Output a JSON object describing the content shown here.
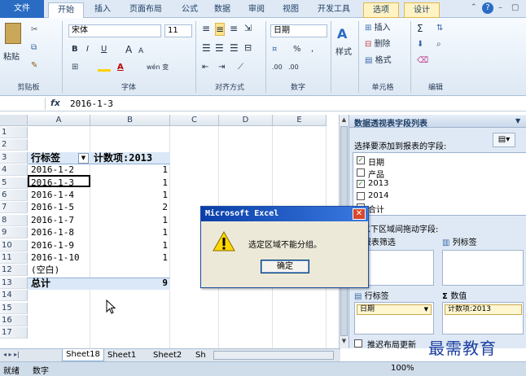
{
  "tabs": {
    "file": "文件",
    "home": "开始",
    "insert": "插入",
    "page_layout": "页面布局",
    "formulas": "公式",
    "data": "数据",
    "review": "审阅",
    "view": "视图",
    "developer": "开发工具",
    "options": "选项",
    "design": "设计"
  },
  "ribbon": {
    "clipboard": {
      "paste": "粘贴",
      "group": "剪贴板"
    },
    "font": {
      "name": "宋体",
      "size": "11",
      "group": "字体",
      "bold": "B",
      "italic": "I",
      "underline": "U",
      "grow": "A",
      "shrink": "A",
      "wen": "wén 变"
    },
    "alignment": {
      "group": "对齐方式"
    },
    "number": {
      "format": "日期",
      "group": "数字",
      "percent": "%",
      "comma": ",",
      "inc": ".00",
      "dec": ".00"
    },
    "styles": {
      "label": "样式"
    },
    "cells": {
      "insert": "插入",
      "delete": "删除",
      "format": "格式",
      "group": "单元格"
    },
    "editing": {
      "sum": "Σ",
      "group": "编辑"
    }
  },
  "formula_bar": {
    "fx": "fx",
    "value": "2016-1-3"
  },
  "columns": [
    "A",
    "B",
    "C",
    "D",
    "E"
  ],
  "rows": [
    {
      "n": "1",
      "a": "",
      "b": ""
    },
    {
      "n": "2",
      "a": "",
      "b": ""
    },
    {
      "n": "3",
      "a": "行标签",
      "b": "计数项:2013"
    },
    {
      "n": "4",
      "a": "2016-1-2",
      "b": "1"
    },
    {
      "n": "5",
      "a": "2016-1-3",
      "b": "1"
    },
    {
      "n": "6",
      "a": "2016-1-4",
      "b": "1"
    },
    {
      "n": "7",
      "a": "2016-1-5",
      "b": "2"
    },
    {
      "n": "8",
      "a": "2016-1-7",
      "b": "1"
    },
    {
      "n": "9",
      "a": "2016-1-8",
      "b": "1"
    },
    {
      "n": "10",
      "a": "2016-1-9",
      "b": "1"
    },
    {
      "n": "11",
      "a": "2016-1-10",
      "b": "1"
    },
    {
      "n": "12",
      "a": "(空白)",
      "b": ""
    },
    {
      "n": "13",
      "a": "总计",
      "b": "9"
    },
    {
      "n": "14",
      "a": "",
      "b": ""
    },
    {
      "n": "15",
      "a": "",
      "b": ""
    },
    {
      "n": "16",
      "a": "",
      "b": ""
    },
    {
      "n": "17",
      "a": "",
      "b": ""
    }
  ],
  "sheets": [
    "Sheet18",
    "Sheet1",
    "Sheet2",
    "Sh"
  ],
  "dialog": {
    "title": "Microsoft Excel",
    "message": "选定区域不能分组。",
    "ok": "确定"
  },
  "pivot_panel": {
    "title": "数据透视表字段列表",
    "choose_label": "选择要添加到报表的字段:",
    "fields": [
      {
        "name": "日期",
        "checked": true
      },
      {
        "name": "产品",
        "checked": false
      },
      {
        "name": "2013",
        "checked": true
      },
      {
        "name": "2014",
        "checked": false
      },
      {
        "name": "合计",
        "checked": false
      }
    ],
    "drag_label": "在以下区域间拖动字段:",
    "report_filter": "报表筛选",
    "column_labels": "列标签",
    "row_labels": "行标签",
    "values": "数值",
    "row_item": "日期",
    "value_item": "计数项:2013",
    "defer_update": "推迟布局更新"
  },
  "status": {
    "ready": "就绪",
    "count": "数字",
    "zoom": "100%"
  },
  "watermark": "最需教育"
}
